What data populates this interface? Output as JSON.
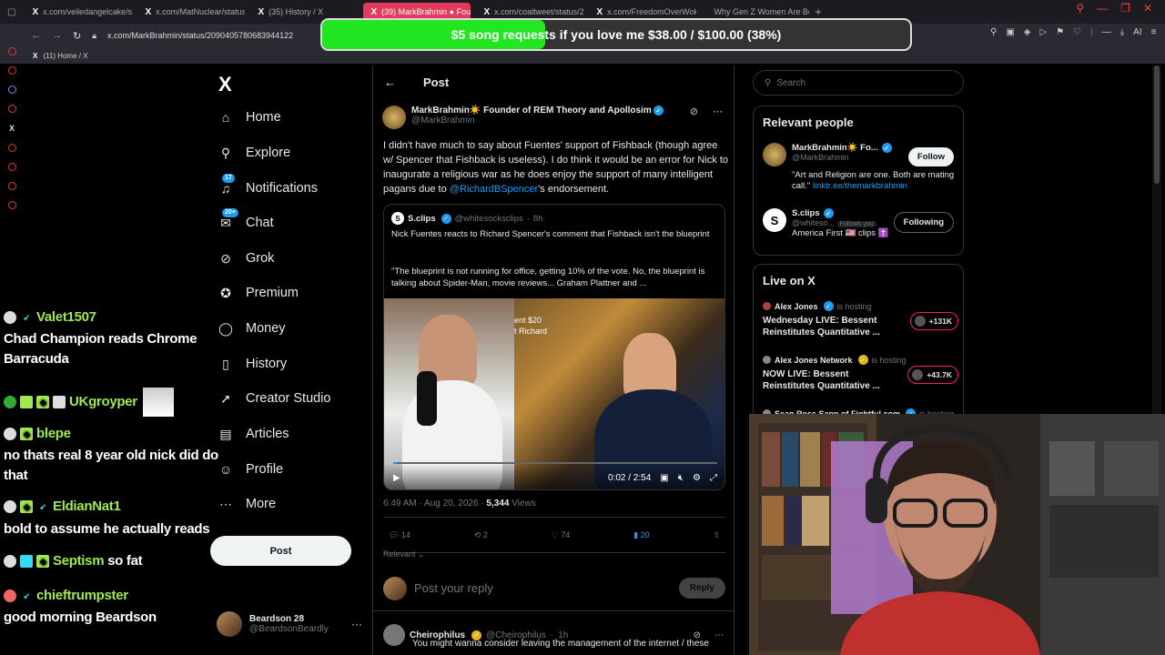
{
  "browser": {
    "tabs": [
      {
        "title": "x.com/veiledangelcake/sta",
        "active": false
      },
      {
        "title": "x.com/MatNuclear/status/",
        "active": false
      },
      {
        "title": "(35) History / X",
        "active": false
      },
      {
        "title": "(39) MarkBrahmin ● Foun",
        "active": true
      },
      {
        "title": "x.com/coaltweet/status/2(",
        "active": false
      },
      {
        "title": "x.com/FreedomOverWoke",
        "active": false
      },
      {
        "title": "Why Gen Z Women Are Be",
        "active": false
      }
    ],
    "new_tab": "+",
    "url": "x.com/MarkBrahmin/status/209040578068394412​2",
    "bookmark": "(11) Home / X",
    "ai_label": "AI"
  },
  "stream_goal": {
    "text": "$5 song requests if you love me $38.00 / $100.00 (38%)",
    "progress": 0.38,
    "color": "#22e622"
  },
  "x_logo": "X",
  "nav": [
    {
      "label": "Home",
      "icon": "home-icon",
      "glyph": "⌂"
    },
    {
      "label": "Explore",
      "icon": "search-icon",
      "glyph": "⚲"
    },
    {
      "label": "Notifications",
      "icon": "bell-icon",
      "glyph": "🔔",
      "badge": "17"
    },
    {
      "label": "Chat",
      "icon": "chat-icon",
      "glyph": "✉",
      "badge": "20+"
    },
    {
      "label": "Grok",
      "icon": "grok-icon",
      "glyph": "⊘"
    },
    {
      "label": "Premium",
      "icon": "premium-icon",
      "glyph": "✪"
    },
    {
      "label": "Money",
      "icon": "money-icon",
      "glyph": "◯"
    },
    {
      "label": "History",
      "icon": "bookmark-icon",
      "glyph": "🔖"
    },
    {
      "label": "Creator Studio",
      "icon": "rocket-icon",
      "glyph": "🚀"
    },
    {
      "label": "Articles",
      "icon": "articles-icon",
      "glyph": "▤"
    },
    {
      "label": "Profile",
      "icon": "profile-icon",
      "glyph": "👤"
    },
    {
      "label": "More",
      "icon": "more-icon",
      "glyph": "⋯"
    }
  ],
  "post_button": "Post",
  "account": {
    "name": "Beardson 28",
    "handle": "@BeardsonBeardly",
    "more": "···"
  },
  "chat": [
    {
      "user": "Valet1507",
      "message": "Chad Champion reads Chrome"
    },
    {
      "message_cont": "Barracuda"
    },
    {
      "user": "UKgroyper",
      "message": ""
    },
    {
      "user": "blepe",
      "message": ""
    },
    {
      "message": "no thats real 8 year old nick did do"
    },
    {
      "message_cont": "that"
    },
    {
      "user": "EldianNat1",
      "message": ""
    },
    {
      "message": "bold to assume he actually reads"
    },
    {
      "user": "Septism",
      "message": "so fat"
    },
    {
      "user": "chieftrumpster",
      "message": ""
    },
    {
      "message": "good morning Beardson"
    }
  ],
  "post": {
    "header": "Post",
    "author_name": "MarkBrahmin☀️ Founder of REM Theory and Apollosim",
    "author_handle": "@MarkBrahmin",
    "text_before": "I didn't have much to say about Fuentes' support of Fishback (though agree w/ Spencer that Fishback is useless). I do think it would be an error for Nick to inaugurate a religious war as he does enjoy the support of many intelligent pagans due to ",
    "mention": "@RichardBSpencer",
    "text_after": "'s endorsement.",
    "quote": {
      "name": "S.clips",
      "handle": "@whitesocksclips",
      "age": "8h",
      "line1": "Nick Fuentes reacts to Richard Spencer's comment that Fishback isn't the blueprint",
      "line2": "\"The blueprint is not running for office, getting 10% of the vote. No, the blueprint is talking about Spider-Man, movie reviews... Graham Plattner and ...",
      "video_overlay_text": "ent $20\nt Richard",
      "time": "0:02 / 2:54",
      "progress": 0.01
    },
    "timestamp": "6:49 AM · Aug 20, 2026 · ",
    "views_count": "5,344",
    "views_label": " Views",
    "replies": "14",
    "reposts": "2",
    "likes": "74",
    "bookmarks": "20",
    "sort": "Relevant ⌄",
    "reply_placeholder": "Post your reply",
    "reply_button": "Reply",
    "next_reply_name": "Cheirophilus",
    "next_reply_handle": "@Cheirophilus",
    "next_reply_age": "1h",
    "next_reply_text": "You might wanna consider leaving the management of the internet / these"
  },
  "search_placeholder": "Search",
  "relevant_people": {
    "title": "Relevant people",
    "people": [
      {
        "name": "MarkBrahmin☀️ Fo...",
        "handle": "@MarkBrahmin",
        "bio": "\"Art and Religion are one. Both are mating call.\" ",
        "bio_link": "linktr.ee/themarkbrahmin",
        "button": "Follow"
      },
      {
        "name": "S.clips",
        "handle": "@whiteso...",
        "follows_you": "Follows you",
        "bio": "America First 🇺🇸 clips ✝️",
        "button": "Following"
      }
    ]
  },
  "live_on_x": {
    "title": "Live on X",
    "items": [
      {
        "host": "Alex Jones",
        "status": "is hosting",
        "title": "Wednesday LIVE: Bessent Reinstitutes Quantitative ...",
        "count": "+131K"
      },
      {
        "host": "Alex Jones Network",
        "status": "is hosting",
        "title": "NOW LIVE: Bessent Reinstitutes Quantitative ...",
        "count": "+43.7K"
      },
      {
        "host": "Sean Ross Sapp of Fightful.com",
        "status": "is hosting",
        "title": ""
      }
    ]
  },
  "colors": {
    "accent": "#1d9bf0",
    "live": "#f91880",
    "chat_user": "#9fea52"
  }
}
